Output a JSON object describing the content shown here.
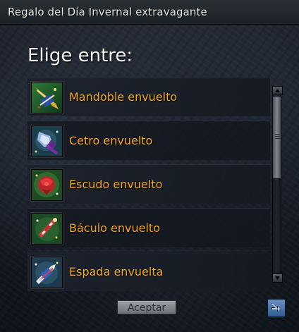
{
  "window": {
    "title": "Regalo del Día Invernal extravagante"
  },
  "main": {
    "heading": "Elige entre:"
  },
  "items": [
    {
      "label": "Mandoble envuelto",
      "icon": "wrapped-greatsword-icon"
    },
    {
      "label": "Cetro envuelto",
      "icon": "wrapped-scepter-icon"
    },
    {
      "label": "Escudo envuelto",
      "icon": "wrapped-shield-icon"
    },
    {
      "label": "Báculo envuelto",
      "icon": "wrapped-staff-icon"
    },
    {
      "label": "Espada envuelta",
      "icon": "wrapped-sword-icon"
    }
  ],
  "actions": {
    "accept_label": "Aceptar"
  },
  "colors": {
    "item_text": "#f5a623",
    "title_text": "#e8e6e0",
    "accent_blue": "#2f5a94"
  }
}
